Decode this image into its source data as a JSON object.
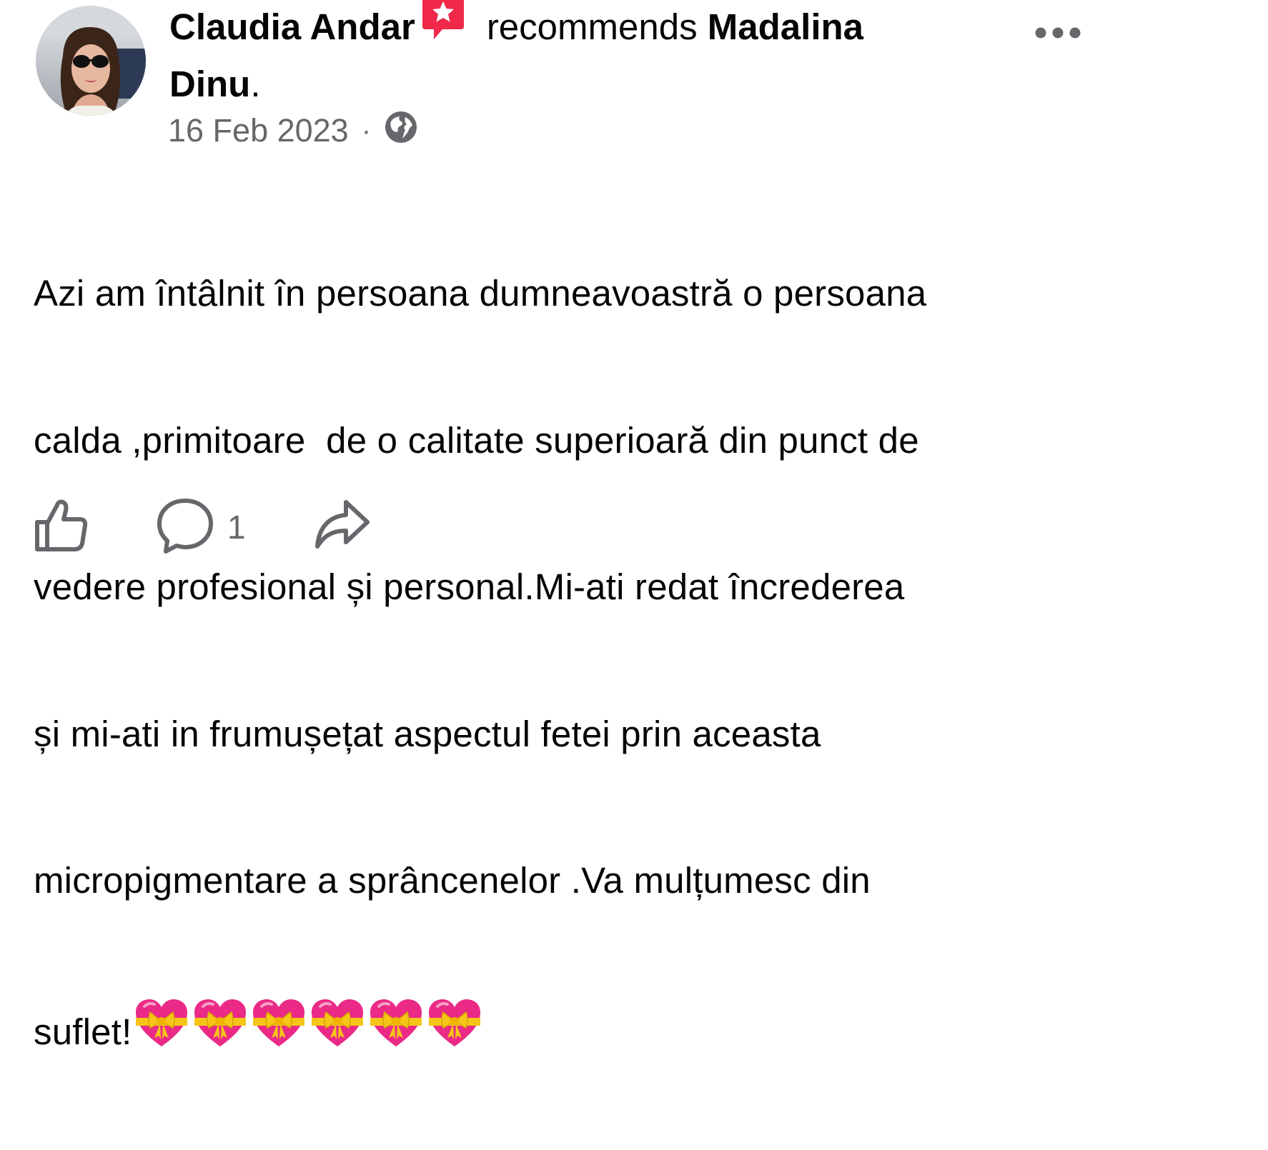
{
  "header": {
    "author_name": "Claudia Andar",
    "verb": "recommends",
    "recommended_name_part1": "Madalina",
    "recommended_name_part2": "Dinu",
    "period": ".",
    "date": "16 Feb 2023",
    "separator": "·",
    "audience_icon": "globe-icon",
    "more_icon": "more-options-icon"
  },
  "body": {
    "lines": [
      "Azi am întâlnit în persoana dumneavoastră o persoana",
      "calda ,primitoare  de o calitate superioară din punct de",
      "vedere profesional și personal.Mi-ati redat încrederea",
      "și mi-ati in frumușețat aspectul fetei prin aceasta",
      "micropigmentare a sprâncenelor .Va mulțumesc din",
      "suflet!"
    ],
    "emoji_name": "heart-with-ribbon-emoji",
    "emoji_count": 6
  },
  "actions": {
    "like_icon": "thumbs-up-icon",
    "comment_icon": "comment-bubble-icon",
    "comment_count": "1",
    "share_icon": "share-arrow-icon"
  },
  "colors": {
    "text": "#050505",
    "secondary_text": "#65676b",
    "badge_red": "#f0284a",
    "heart_pink": "#ea2a86",
    "ribbon_yellow": "#f5c518"
  }
}
